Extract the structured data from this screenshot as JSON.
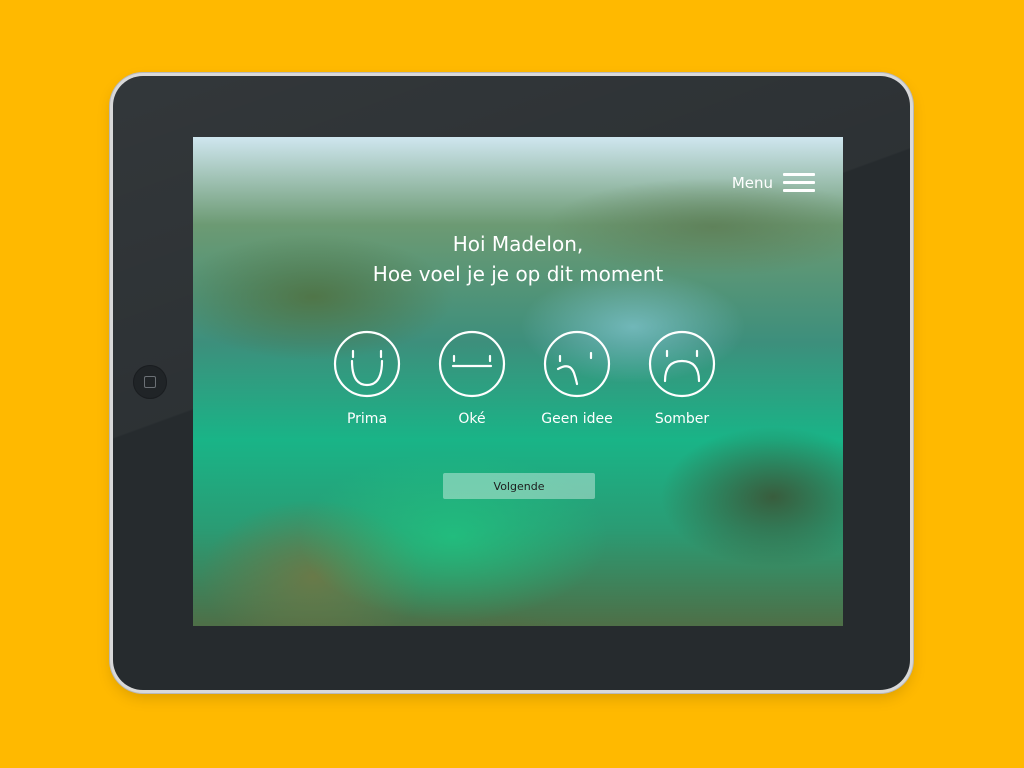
{
  "app": {
    "menu_label": "Menu",
    "greeting_line1": "Hoi Madelon,",
    "greeting_line2": "Hoe voel je je op dit moment",
    "moods": [
      {
        "label": "Prima",
        "icon": "happy-face-icon"
      },
      {
        "label": "Oké",
        "icon": "neutral-face-icon"
      },
      {
        "label": "Geen idee",
        "icon": "confused-face-icon"
      },
      {
        "label": "Somber",
        "icon": "sad-face-icon"
      }
    ],
    "next_label": "Volgende"
  },
  "colors": {
    "background": "#FFB900",
    "device_frame": "#262B2E",
    "text": "#FFFFFF",
    "button": "#FFFFFF"
  }
}
